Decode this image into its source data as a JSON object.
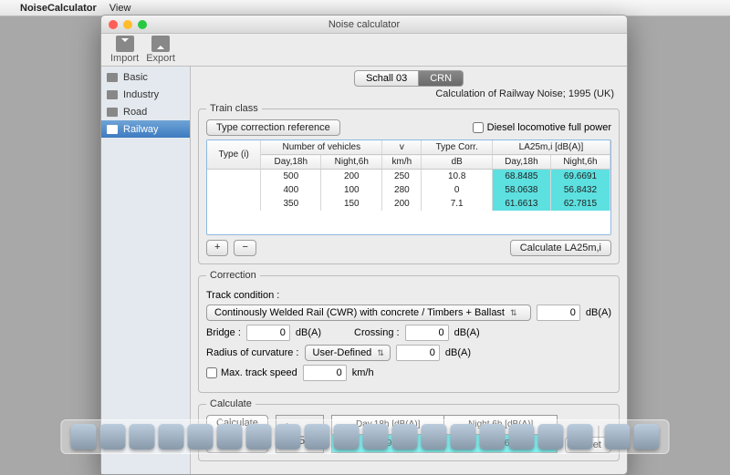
{
  "menubar": {
    "app": "NoiseCalculator",
    "items": [
      "View"
    ]
  },
  "window": {
    "title": "Noise calculator",
    "toolbar": {
      "import": "Import",
      "export": "Export"
    }
  },
  "sidebar": {
    "items": [
      {
        "label": "Basic"
      },
      {
        "label": "Industry"
      },
      {
        "label": "Road"
      },
      {
        "label": "Railway",
        "selected": true
      }
    ]
  },
  "tabs": {
    "left": "Schall 03",
    "right": "CRN"
  },
  "subtitle": "Calculation of Railway Noise; 1995 (UK)",
  "train": {
    "legend": "Train class",
    "type_corr_btn": "Type correction reference",
    "diesel_label": "Diesel locomotive full power",
    "headers": {
      "type": "Type (i)",
      "num_vehicles": "Number of vehicles",
      "v": "v",
      "type_corr": "Type Corr.",
      "la25": "LA25m,i [dB(A)]",
      "day": "Day,18h",
      "night": "Night,6h",
      "kmh": "km/h",
      "db": "dB"
    },
    "rows": [
      {
        "day_n": "500",
        "night_n": "200",
        "v": "250",
        "tc": "10.8",
        "la_day": "68.8485",
        "la_night": "69.6691"
      },
      {
        "day_n": "400",
        "night_n": "100",
        "v": "280",
        "tc": "0",
        "la_day": "58.0638",
        "la_night": "56.8432"
      },
      {
        "day_n": "350",
        "night_n": "150",
        "v": "200",
        "tc": "7.1",
        "la_day": "61.6613",
        "la_night": "62.7815"
      }
    ],
    "add": "+",
    "remove": "−",
    "calc": "Calculate LA25m,i"
  },
  "correction": {
    "legend": "Correction",
    "track_label": "Track condition :",
    "track_select": "Continously Welded Rail (CWR) with concrete / Timbers + Ballast",
    "track_val": "0",
    "dba": "dB(A)",
    "bridge_label": "Bridge :",
    "bridge_val": "0",
    "crossing_label": "Crossing :",
    "crossing_val": "0",
    "radius_label": "Radius of curvature :",
    "radius_select": "User-Defined",
    "radius_val": "0",
    "max_label": "Max. track speed",
    "max_val": "0",
    "kmh": "km/h"
  },
  "calculate": {
    "legend": "Calculate",
    "btn": "Calculate",
    "la_label": "L A25m",
    "col_day": "Day,18h [dB(A)]",
    "col_night": "Night,6h [dB(A)]",
    "val_day": "69.902",
    "val_night": "70.662",
    "reset": "Reset"
  }
}
